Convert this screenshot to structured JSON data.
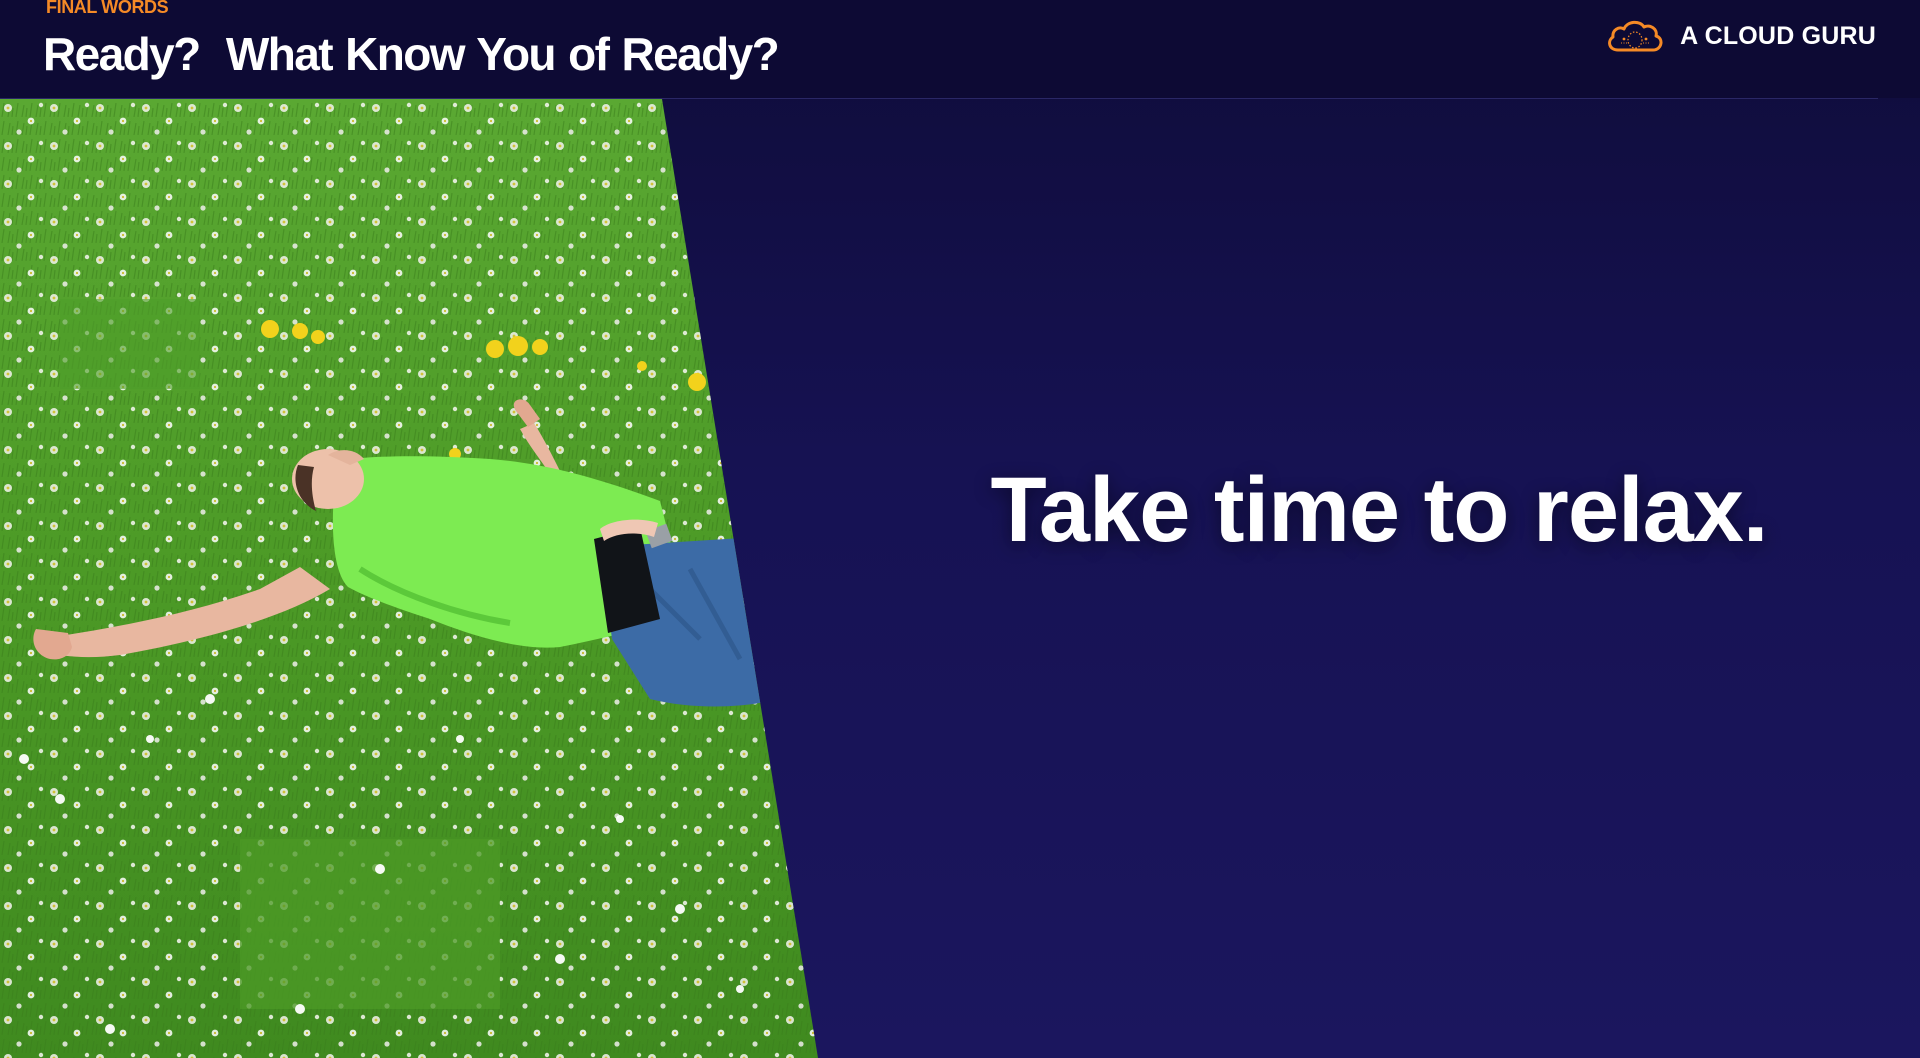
{
  "header": {
    "section_label": "FINAL WORDS",
    "title": "Ready?  What Know You of Ready?"
  },
  "brand": {
    "logo_icon": "cloud-logo-icon",
    "name": "A CLOUD GURU",
    "logo_color": "#f58a26"
  },
  "photo": {
    "subject": "man relaxing on grass with daisies"
  },
  "main": {
    "tagline": "Take time to relax."
  },
  "colors": {
    "background": "#161253",
    "header_background": "#0d0a34",
    "accent": "#f58a26",
    "text": "#ffffff",
    "grass": "#4f9e2a"
  }
}
